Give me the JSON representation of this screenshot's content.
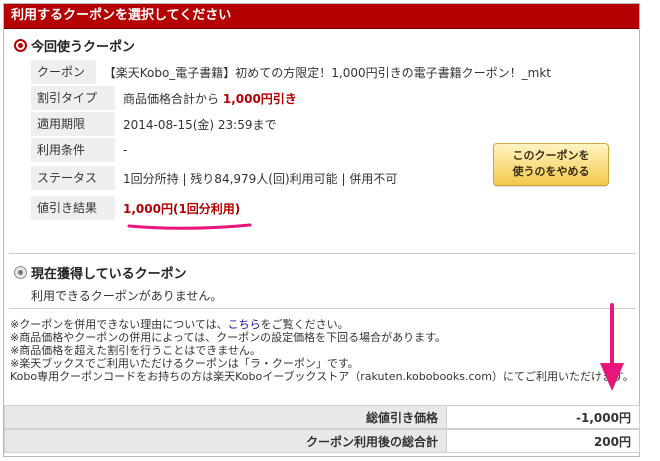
{
  "header": {
    "title": "利用するクーポンを選択してください"
  },
  "current": {
    "title": "今回使うクーポン",
    "rows": [
      {
        "label": "クーポン名",
        "value": "【楽天Kobo_電子書籍】初めての方限定！1,000円引きの電子書籍クーポン！_mkt"
      },
      {
        "label": "割引タイプ",
        "value": "商品価格合計から",
        "value_red": "1,000円引き"
      },
      {
        "label": "適用期限",
        "value": "2014-08-15(金) 23:59まで"
      },
      {
        "label": "利用条件",
        "value": "-"
      },
      {
        "label": "ステータス",
        "value": "1回分所持 | 残り84,979人(回)利用可能 | 併用不可"
      },
      {
        "label": "値引き結果",
        "value_red": "1,000円(1回分利用)"
      }
    ],
    "cancel_button": {
      "line1": "このクーポンを",
      "line2": "使うのをやめる"
    }
  },
  "acquired": {
    "title": "現在獲得しているクーポン",
    "message": "利用できるクーポンがありません。"
  },
  "notes": {
    "line1_prefix": "※クーポンを併用できない理由については、",
    "line1_link": "こちら",
    "line1_suffix": "をご覧ください。",
    "line2": "※商品価格やクーポンの併用によっては、クーポンの設定価格を下回る場合があります。",
    "line3": "※商品価格を超えた割引を行うことはできません。",
    "line4": "※楽天ブックスでご利用いただけるクーポンは「ラ・クーポン」です。",
    "line5": "Kobo専用クーポンコードをお持ちの方は楽天Koboイーブックストア（rakuten.kobobooks.com）にてご利用いただけます。"
  },
  "totals": [
    {
      "label": "総値引き価格",
      "value": "-1,000円"
    },
    {
      "label": "クーポン利用後の総合計",
      "value": "200円"
    }
  ],
  "colors": {
    "header_bg": "#b40000",
    "accent_red": "#b40000",
    "annotation_pink": "#e8157a",
    "button_gold": "#f3c94b"
  }
}
